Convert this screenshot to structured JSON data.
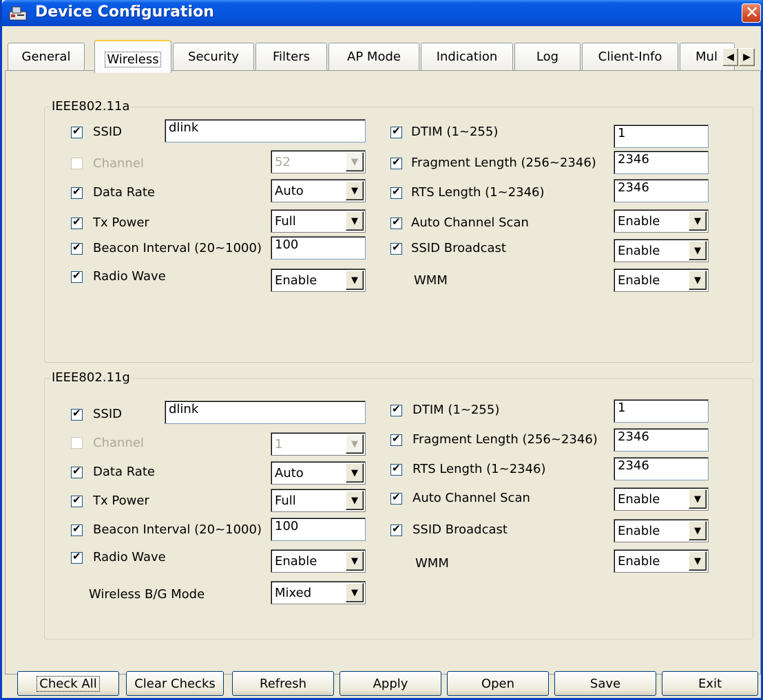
{
  "window": {
    "title": "Device Configuration",
    "close_glyph": "✕"
  },
  "tabs": [
    "General",
    "Wireless",
    "Security",
    "Filters",
    "AP Mode",
    "Indication",
    "Log",
    "Client-Info",
    "Mul"
  ],
  "active_tab": "Wireless",
  "tab_scroll": {
    "left": "◀",
    "right": "▶"
  },
  "group_a": {
    "title": "IEEE802.11a",
    "ssid": {
      "label": "SSID",
      "value": "dlink",
      "checked": true
    },
    "channel": {
      "label": "Channel",
      "value": "52",
      "checked": false,
      "disabled": true
    },
    "data_rate": {
      "label": "Data Rate",
      "value": "Auto",
      "checked": true
    },
    "tx_power": {
      "label": "Tx Power",
      "value": "Full",
      "checked": true
    },
    "beacon": {
      "label": "Beacon Interval (20~1000)",
      "value": "100",
      "checked": true
    },
    "radio_wave": {
      "label": "Radio Wave",
      "value": "Enable",
      "checked": true
    },
    "dtim": {
      "label": "DTIM (1~255)",
      "value": "1",
      "checked": true
    },
    "frag": {
      "label": "Fragment Length (256~2346)",
      "value": "2346",
      "checked": true
    },
    "rts": {
      "label": "RTS Length (1~2346)",
      "value": "2346",
      "checked": true
    },
    "auto_scan": {
      "label": "Auto Channel Scan",
      "value": "Enable",
      "checked": true
    },
    "ssid_bcast": {
      "label": "SSID Broadcast",
      "value": "Enable",
      "checked": true
    },
    "wmm": {
      "label": "WMM",
      "value": "Enable"
    }
  },
  "group_g": {
    "title": "IEEE802.11g",
    "ssid": {
      "label": "SSID",
      "value": "dlink",
      "checked": true
    },
    "channel": {
      "label": "Channel",
      "value": "1",
      "checked": false,
      "disabled": true
    },
    "data_rate": {
      "label": "Data Rate",
      "value": "Auto",
      "checked": true
    },
    "tx_power": {
      "label": "Tx Power",
      "value": "Full",
      "checked": true
    },
    "beacon": {
      "label": "Beacon Interval (20~1000)",
      "value": "100",
      "checked": true
    },
    "radio_wave": {
      "label": "Radio Wave",
      "value": "Enable",
      "checked": true
    },
    "bg_mode": {
      "label": "Wireless B/G Mode",
      "value": "Mixed"
    },
    "dtim": {
      "label": "DTIM (1~255)",
      "value": "1",
      "checked": true
    },
    "frag": {
      "label": "Fragment Length (256~2346)",
      "value": "2346",
      "checked": true
    },
    "rts": {
      "label": "RTS Length (1~2346)",
      "value": "2346",
      "checked": true
    },
    "auto_scan": {
      "label": "Auto Channel Scan",
      "value": "Enable",
      "checked": true
    },
    "ssid_bcast": {
      "label": "SSID Broadcast",
      "value": "Enable",
      "checked": true
    },
    "wmm": {
      "label": "WMM",
      "value": "Enable"
    }
  },
  "buttons": {
    "check_all": "Check All",
    "clear_checks": "Clear Checks",
    "refresh": "Refresh",
    "apply": "Apply",
    "open": "Open",
    "save": "Save",
    "exit": "Exit"
  },
  "select_arrow": "▼",
  "checkmark": "✔",
  "colors": {
    "titlebar": "#0654dc",
    "face": "#ece9d8",
    "close": "#d8502f",
    "tab_highlight": "#ffc83c"
  }
}
